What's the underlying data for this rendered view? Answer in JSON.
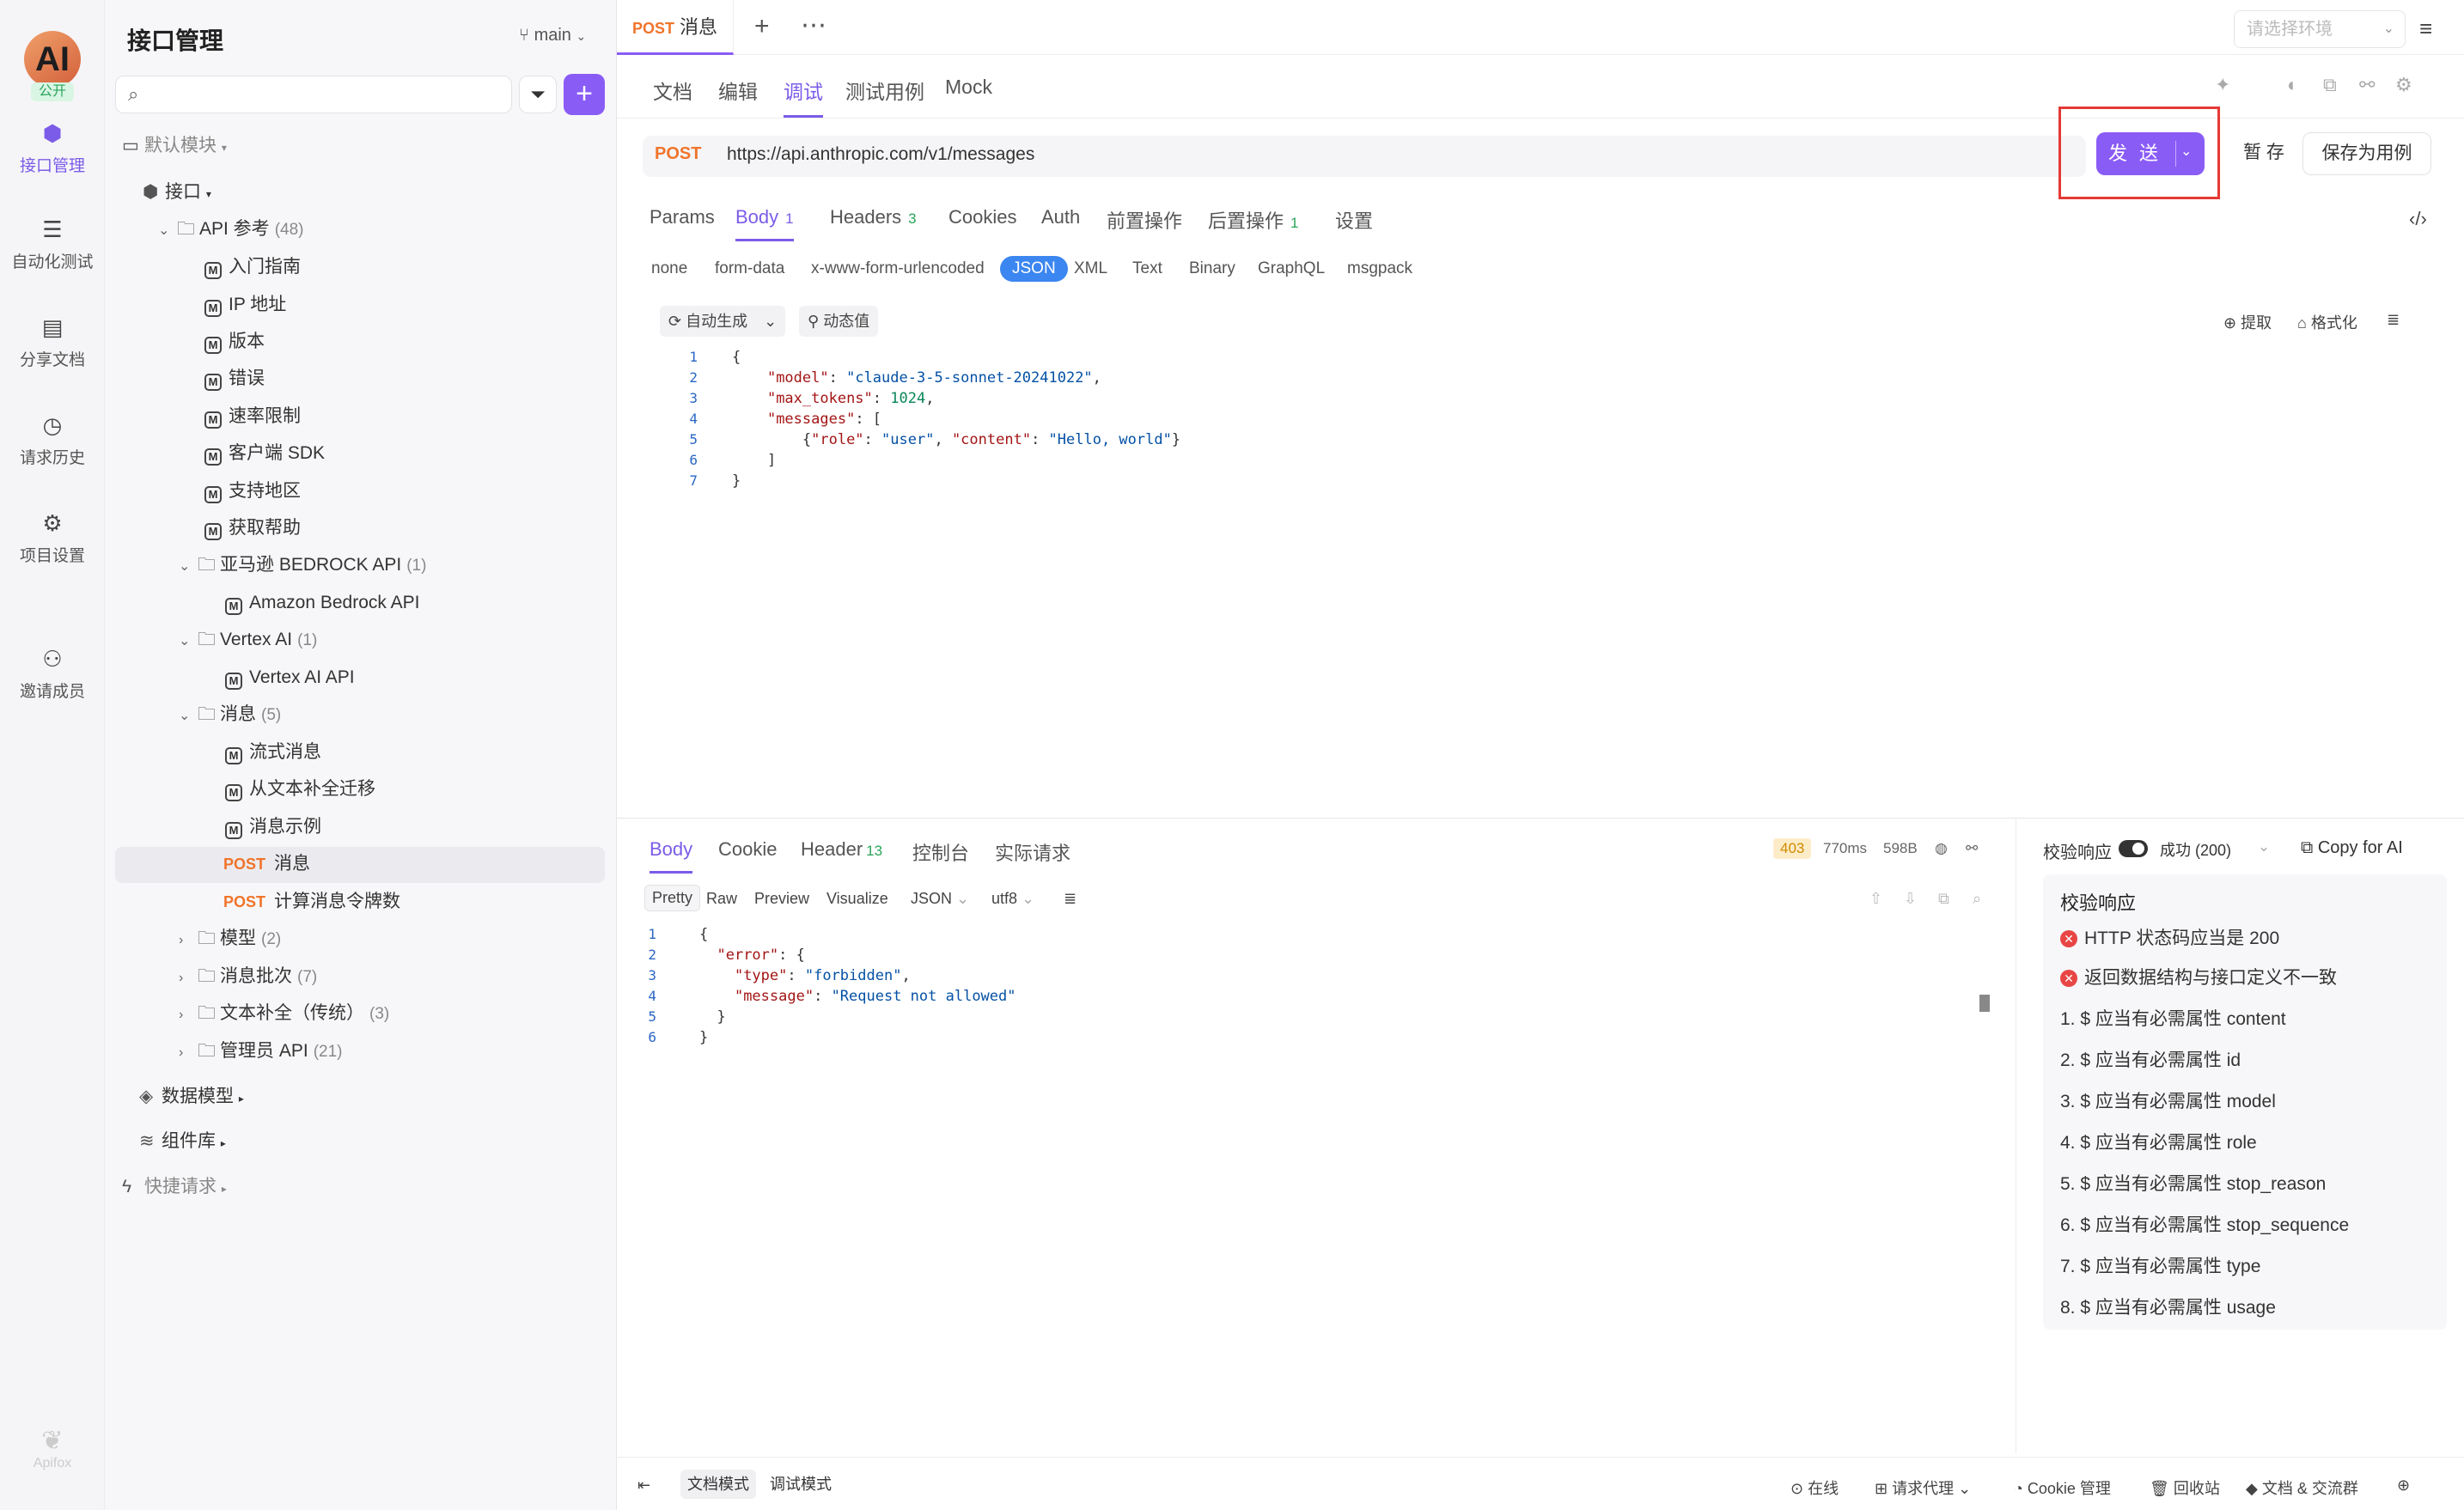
{
  "rail": {
    "logo": "AI",
    "public_badge": "公开",
    "items": [
      {
        "label": "接口管理",
        "icon": "api-icon"
      },
      {
        "label": "自动化测试",
        "icon": "stack-icon"
      },
      {
        "label": "分享文档",
        "icon": "book-icon"
      },
      {
        "label": "请求历史",
        "icon": "clock-icon"
      },
      {
        "label": "项目设置",
        "icon": "gear-icon"
      },
      {
        "label": "邀请成员",
        "icon": "user-plus-icon"
      }
    ],
    "brand": "Apifox"
  },
  "tree": {
    "title": "接口管理",
    "branch": "main",
    "search_placeholder": "",
    "default_module": "默认模块",
    "root": "接口",
    "nodes": [
      {
        "label": "API 参考",
        "count": "(48)"
      },
      {
        "label": "入门指南"
      },
      {
        "label": "IP 地址"
      },
      {
        "label": "版本"
      },
      {
        "label": "错误"
      },
      {
        "label": "速率限制"
      },
      {
        "label": "客户端 SDK"
      },
      {
        "label": "支持地区"
      },
      {
        "label": "获取帮助"
      },
      {
        "label": "亚马逊 BEDROCK API",
        "count": "(1)"
      },
      {
        "label": "Amazon Bedrock API"
      },
      {
        "label": "Vertex AI",
        "count": "(1)"
      },
      {
        "label": "Vertex AI API"
      },
      {
        "label": "消息",
        "count": "(5)"
      },
      {
        "label": "流式消息"
      },
      {
        "label": "从文本补全迁移"
      },
      {
        "label": "消息示例"
      },
      {
        "label": "消息",
        "method": "POST"
      },
      {
        "label": "计算消息令牌数",
        "method": "POST"
      },
      {
        "label": "模型",
        "count": "(2)"
      },
      {
        "label": "消息批次",
        "count": "(7)"
      },
      {
        "label": "文本补全（传统）",
        "count": "(3)"
      },
      {
        "label": "管理员 API",
        "count": "(21)"
      }
    ],
    "sections": [
      "数据模型",
      "组件库",
      "快捷请求"
    ]
  },
  "tabbar": {
    "tab_method": "POST",
    "tab_label": "消息",
    "env_placeholder": "请选择环境"
  },
  "subtabs": [
    "文档",
    "编辑",
    "调试",
    "测试用例",
    "Mock"
  ],
  "request": {
    "method": "POST",
    "url": "https://api.anthropic.com/v1/messages",
    "send": "发 送",
    "save_temp": "暂 存",
    "save_case": "保存为用例"
  },
  "param_tabs": [
    {
      "label": "Params"
    },
    {
      "label": "Body",
      "count": "1"
    },
    {
      "label": "Headers",
      "count": "3"
    },
    {
      "label": "Cookies"
    },
    {
      "label": "Auth"
    },
    {
      "label": "前置操作"
    },
    {
      "label": "后置操作",
      "count": "1"
    },
    {
      "label": "设置"
    }
  ],
  "body_types": [
    "none",
    "form-data",
    "x-www-form-urlencoded",
    "JSON",
    "XML",
    "Text",
    "Binary",
    "GraphQL",
    "msgpack"
  ],
  "body_tools": {
    "auto": "自动生成",
    "dynamic": "动态值",
    "extract": "提取",
    "format": "格式化"
  },
  "request_body_lines": [
    "1",
    "2",
    "3",
    "4",
    "5",
    "6",
    "7"
  ],
  "response": {
    "tabs": [
      {
        "label": "Body"
      },
      {
        "label": "Cookie"
      },
      {
        "label": "Header",
        "count": "13"
      },
      {
        "label": "控制台"
      },
      {
        "label": "实际请求"
      }
    ],
    "status": "403",
    "time": "770ms",
    "size": "598B",
    "formats": [
      "Pretty",
      "Raw",
      "Preview",
      "Visualize"
    ],
    "lang": "JSON",
    "encoding": "utf8",
    "lines": [
      "1",
      "2",
      "3",
      "4",
      "5",
      "6"
    ]
  },
  "validation": {
    "label": "校验响应",
    "result": "成功 (200)",
    "copy": "Copy for AI",
    "title": "校验响应",
    "errors": [
      "HTTP 状态码应当是 200",
      "返回数据结构与接口定义不一致"
    ],
    "items": [
      "1. $ 应当有必需属性 content",
      "2. $ 应当有必需属性 id",
      "3. $ 应当有必需属性 model",
      "4. $ 应当有必需属性 role",
      "5. $ 应当有必需属性 stop_reason",
      "6. $ 应当有必需属性 stop_sequence",
      "7. $ 应当有必需属性 type",
      "8. $ 应当有必需属性 usage"
    ]
  },
  "footer": {
    "doc_mode": "文档模式",
    "debug_mode": "调试模式",
    "online": "在线",
    "proxy": "请求代理",
    "cookie": "Cookie 管理",
    "trash": "回收站",
    "community": "文档 & 交流群"
  },
  "colors": {
    "accent": "#8a5cf6",
    "post": "#f0742b",
    "error": "#e84545",
    "highlight": "#e53935"
  }
}
